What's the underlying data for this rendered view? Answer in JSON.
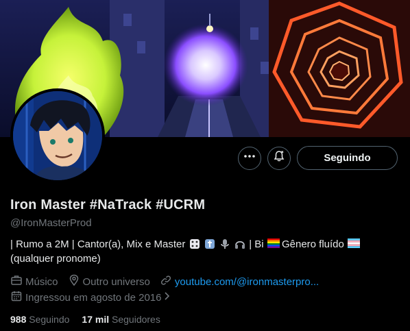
{
  "profile": {
    "display_name": "Iron Master #NaTrack #UCRM",
    "handle": "@IronMasterProd",
    "bio_line1_a": "| Rumo a 2M | Cantor(a), Mix e Master",
    "bio_line1_b": "| Bi",
    "bio_line1_c": "Gênero fluído",
    "bio_line2": "(qualquer pronome)",
    "category": "Músico",
    "location": "Outro universo",
    "website": "youtube.com/@ironmasterpro...",
    "joined": "Ingressou em agosto de 2016",
    "following_count": "988",
    "following_label": "Seguindo",
    "followers_count": "17 mil",
    "followers_label": "Seguidores"
  },
  "actions": {
    "more_icon": "more-horizontal-icon",
    "notify_icon": "bell-notification-icon",
    "follow_label": "Seguindo"
  },
  "icons": {
    "category": "briefcase-icon",
    "location": "location-pin-icon",
    "website": "link-icon",
    "joined": "calendar-icon",
    "joined_chevron": "chevron-right-icon"
  },
  "colors": {
    "background": "#000000",
    "link": "#1d9bf0",
    "muted": "#71767b",
    "border": "#536471"
  }
}
